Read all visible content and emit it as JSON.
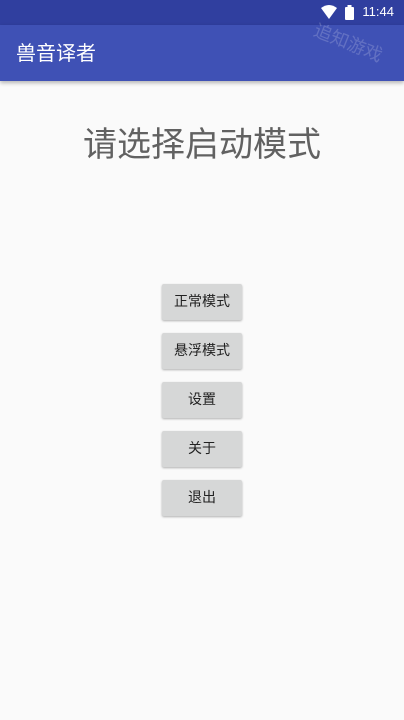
{
  "status_bar": {
    "time": "11:44",
    "icons": [
      "wifi-icon",
      "battery-icon"
    ]
  },
  "app_bar": {
    "title": "兽音译者",
    "watermark": "追知游戏"
  },
  "main": {
    "heading": "请选择启动模式",
    "buttons": [
      {
        "label": "正常模式"
      },
      {
        "label": "悬浮模式"
      },
      {
        "label": "设置"
      },
      {
        "label": "关于"
      },
      {
        "label": "退出"
      }
    ]
  },
  "colors": {
    "status_bar": "#303f9f",
    "app_bar": "#3f51b5",
    "background": "#fafafa",
    "button": "#d6d7d7",
    "heading_text": "#616161"
  }
}
